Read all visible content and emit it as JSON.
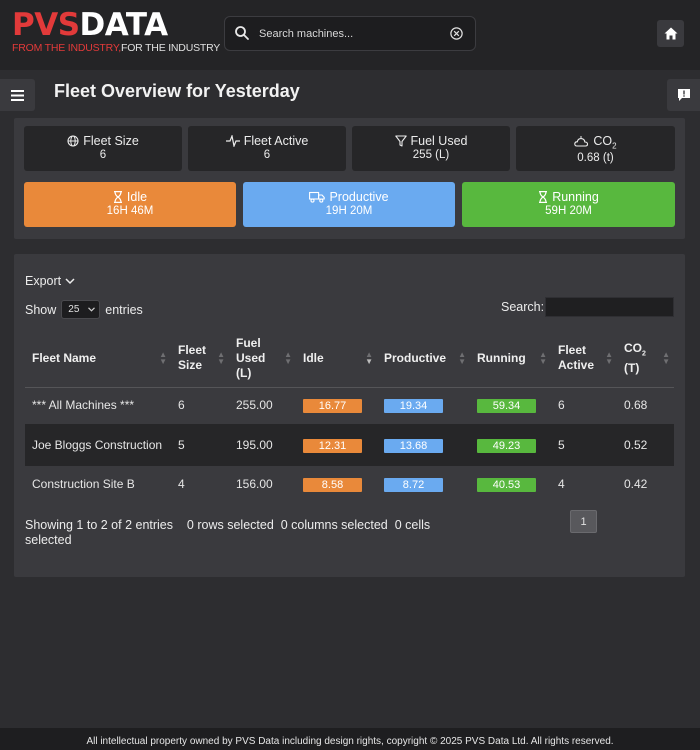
{
  "brand": {
    "logo_pvs": "PVS",
    "logo_data": "DATA",
    "tagline_from": "FROM THE INDUSTRY,",
    "tagline_for": "FOR THE INDUSTRY"
  },
  "header": {
    "search_placeholder": "Search machines...",
    "icons": {
      "search": "search-icon",
      "clear": "clear-circle-icon",
      "home": "home-icon"
    }
  },
  "page": {
    "title": "Fleet Overview for Yesterday",
    "icons": {
      "menu": "hamburger-menu-icon",
      "alert": "feedback-icon"
    }
  },
  "stats": {
    "fleet_size": {
      "label": "Fleet Size",
      "value": "6",
      "icon": "globe-icon"
    },
    "fleet_active": {
      "label": "Fleet Active",
      "value": "6",
      "icon": "pulse-icon"
    },
    "fuel_used": {
      "label": "Fuel Used",
      "value": "255 (L)",
      "icon": "funnel-icon"
    },
    "co2": {
      "label": "CO",
      "label_sub": "2",
      "value": "0.68 (t)",
      "icon": "co2-cloud-icon"
    }
  },
  "times": {
    "idle": {
      "label": "Idle",
      "value": "16H 46M",
      "icon": "hourglass-icon",
      "color": "#e9893a"
    },
    "productive": {
      "label": "Productive",
      "value": "19H 20M",
      "icon": "truck-icon",
      "color": "#6aaaf0"
    },
    "running": {
      "label": "Running",
      "value": "59H 20M",
      "icon": "hourglass-icon",
      "color": "#58b83e"
    }
  },
  "table_controls": {
    "export_label": "Export",
    "show_label": "Show",
    "entries_value": "25",
    "entries_label": "entries",
    "search_label": "Search:"
  },
  "table": {
    "columns": [
      {
        "label": "Fleet Name"
      },
      {
        "label": "Fleet Size"
      },
      {
        "label": "Fuel Used (L)"
      },
      {
        "label": "Idle"
      },
      {
        "label": "Productive"
      },
      {
        "label": "Running"
      },
      {
        "label": "Fleet Active"
      },
      {
        "label": "CO",
        "sub": "2",
        "suffix": "(T)"
      }
    ],
    "rows": [
      {
        "name": "*** All Machines ***",
        "size": "6",
        "fuel": "255.00",
        "idle": "16.77",
        "productive": "19.34",
        "running": "59.34",
        "active": "6",
        "co2": "0.68"
      },
      {
        "name": "Joe Bloggs Construction",
        "size": "5",
        "fuel": "195.00",
        "idle": "12.31",
        "productive": "13.68",
        "running": "49.23",
        "active": "5",
        "co2": "0.52"
      },
      {
        "name": "Construction Site B",
        "size": "4",
        "fuel": "156.00",
        "idle": "8.58",
        "productive": "8.72",
        "running": "40.53",
        "active": "4",
        "co2": "0.42"
      }
    ]
  },
  "table_footer": {
    "info": "Showing 1 to 2 of 2 entries",
    "rows_selected": "0 rows selected",
    "columns_selected": "0 columns selected",
    "cells_selected": "0 cells selected",
    "current_page": "1"
  },
  "footer": {
    "text": "All intellectual property owned by PVS Data including design rights, copyright © 2025 PVS Data Ltd. All rights reserved."
  }
}
